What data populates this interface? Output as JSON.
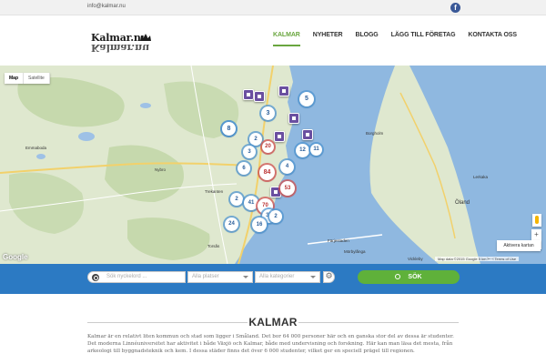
{
  "topbar": {
    "email": "info@kalmar.nu",
    "social_icon": "facebook-icon"
  },
  "header": {
    "logo_text": "Kalmar.nu",
    "nav": [
      {
        "label": "KALMAR",
        "active": true
      },
      {
        "label": "NYHETER",
        "active": false
      },
      {
        "label": "BLOGG",
        "active": false
      },
      {
        "label": "LÄGG TILL FÖRETAG",
        "active": false
      },
      {
        "label": "KONTAKTA OSS",
        "active": false
      }
    ],
    "accent_color": "#6aa63f"
  },
  "map": {
    "type_buttons": {
      "map": "Map",
      "satellite": "Satellite"
    },
    "brand": "Google",
    "footer": "Map data ©2015 Google   5 km ⊢⊣   Terms of Use",
    "activate_label": "Aktivera kartan",
    "zoom": {
      "in": "+",
      "out": "−"
    },
    "clusters": [
      "6",
      "5",
      "3",
      "8",
      "2",
      "20",
      "12",
      "11",
      "3",
      "4",
      "84",
      "6",
      "53",
      "2",
      "41",
      "70",
      "37",
      "2",
      "24",
      "16"
    ],
    "place_labels": [
      "Emmaboda",
      "Nybro",
      "Kalmar",
      "Färjestaden",
      "Mörbylånga",
      "Borgholm",
      "Öland",
      "Lerkaka",
      "Vickleby",
      "Trekanten",
      "Torsås"
    ]
  },
  "search": {
    "keyword_placeholder": "Sök nyckelord ...",
    "places_placeholder": "Alla platser",
    "category_placeholder": "Alla kategorier",
    "submit_label": "SÖK",
    "bar_color": "#2c7ac3",
    "button_color": "#5fb13a"
  },
  "content": {
    "heading": "KALMAR",
    "paragraph": "Kalmar är en relativt liten kommun och stad som ligger i Småland. Det bor 64 000 personer här och en ganska stor del av dessa är studenter. Det moderna Linnéuniversitet har aktivitet i både Växjö och Kalmar, både med undervisning och forskning. Här kan man läsa det mesta, från arkeologi till byggnadsteknik och kem. I dessa städer finns det över 6 000 studenter, vilket ger en speciell prägel till regionen."
  }
}
